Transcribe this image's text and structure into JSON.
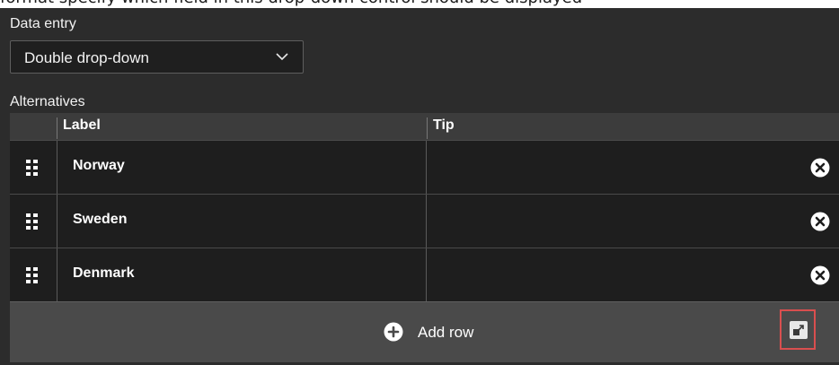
{
  "top_cut_text": "format specify which field in this drop-down control should be displayed",
  "data_entry": {
    "label": "Data entry",
    "selected": "Double drop-down",
    "chevron_icon": "chevron-down-icon"
  },
  "alternatives": {
    "label": "Alternatives",
    "columns": [
      "Label",
      "Tip"
    ],
    "rows": [
      {
        "label": "Norway",
        "tip": ""
      },
      {
        "label": "Sweden",
        "tip": ""
      },
      {
        "label": "Denmark",
        "tip": ""
      }
    ],
    "drag_icon": "drag-handle-icon",
    "remove_icon": "remove-circle-x-icon"
  },
  "footer": {
    "add_row_label": "Add row",
    "add_icon": "plus-circle-icon",
    "expand_icon": "expand-icon",
    "highlight_color": "#d94f4f"
  },
  "colors": {
    "panel_bg": "#2c2c2c",
    "row_bg": "#1e1e1e",
    "header_bg": "#3c3c3c",
    "footer_bg": "#4a4a4a",
    "text": "#ffffff"
  }
}
